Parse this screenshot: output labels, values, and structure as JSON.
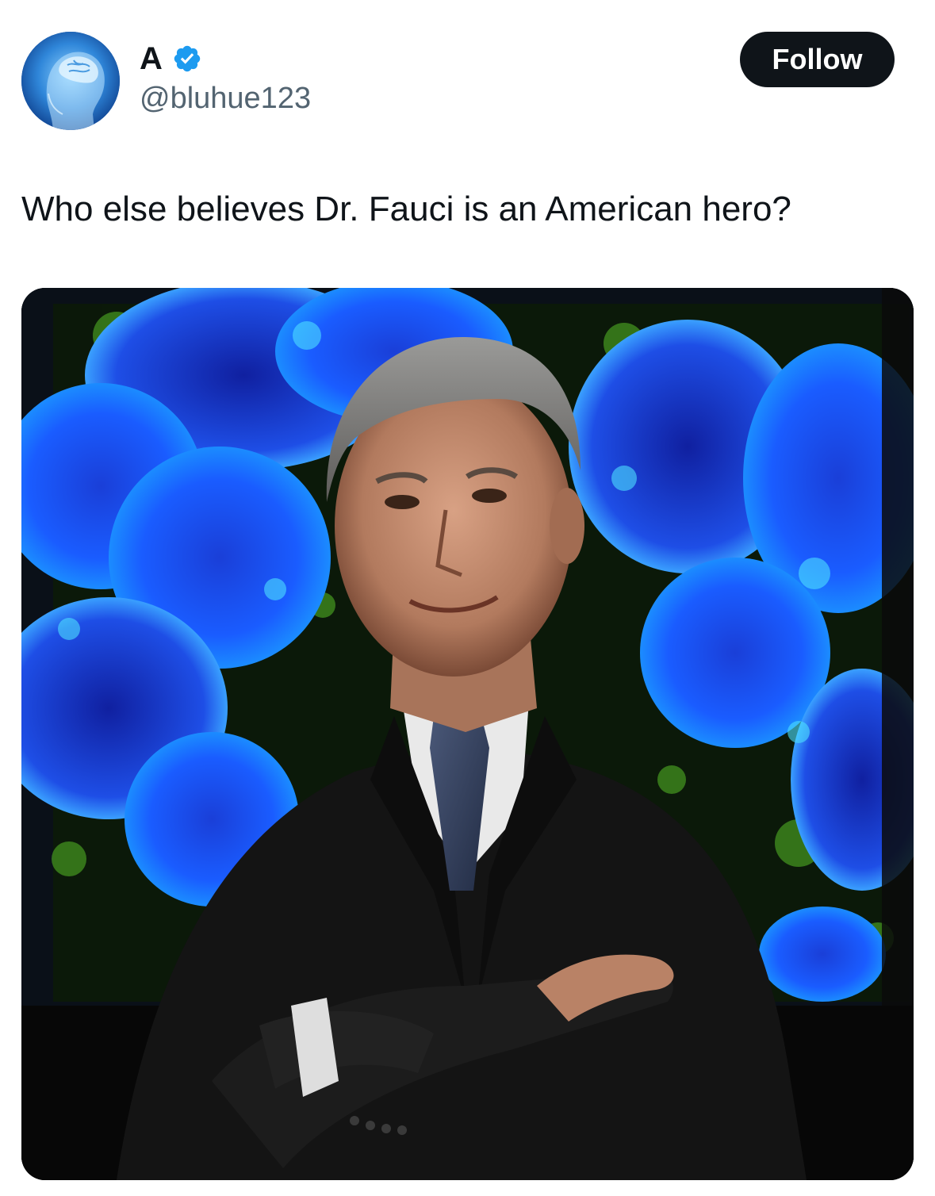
{
  "author": {
    "display_name": "A",
    "handle": "@bluhue123",
    "verified": true,
    "avatar_icon": "brain-head-icon",
    "verified_icon": "verified-badge-icon"
  },
  "actions": {
    "follow_label": "Follow"
  },
  "tweet": {
    "text": "Who else believes Dr. Fauci is an American hero?"
  },
  "colors": {
    "verified_blue": "#1d9bf0",
    "follow_button_bg": "#0f1419",
    "handle_gray": "#536471"
  }
}
